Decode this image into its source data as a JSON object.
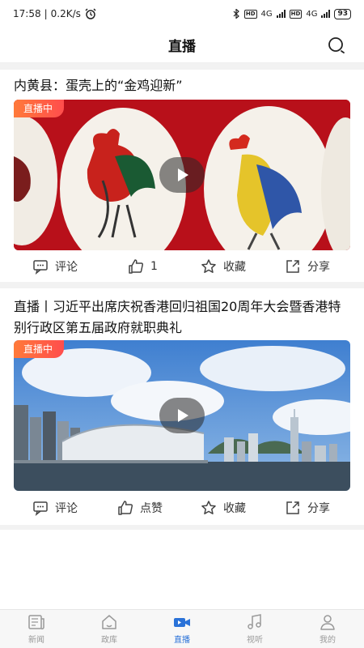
{
  "status_bar": {
    "time": "17:58",
    "net_speed": "0.2K/s",
    "net_label_1": "4G",
    "net_label_2": "4G",
    "hd_1": "HD",
    "hd_2": "HD",
    "battery": "93"
  },
  "header": {
    "title": "直播"
  },
  "cards": [
    {
      "title": "内黄县：蛋壳上的“金鸡迎新”",
      "badge": "直播中",
      "actions": {
        "comment": "评论",
        "like": "1",
        "collect": "收藏",
        "share": "分享"
      }
    },
    {
      "title": "直播丨习近平出席庆祝香港回归祖国20周年大会暨香港特别行政区第五届政府就职典礼",
      "badge": "直播中",
      "actions": {
        "comment": "评论",
        "like": "点赞",
        "collect": "收藏",
        "share": "分享"
      }
    }
  ],
  "tabbar": {
    "items": [
      {
        "label": "新闻",
        "icon": "news-icon"
      },
      {
        "label": "政库",
        "icon": "home-icon"
      },
      {
        "label": "直播",
        "icon": "live-camera-icon",
        "active": true
      },
      {
        "label": "视听",
        "icon": "music-icon"
      },
      {
        "label": "我的",
        "icon": "user-icon"
      }
    ]
  },
  "colors": {
    "accent": "#2a72d8",
    "badge": "#ff5a3d"
  }
}
